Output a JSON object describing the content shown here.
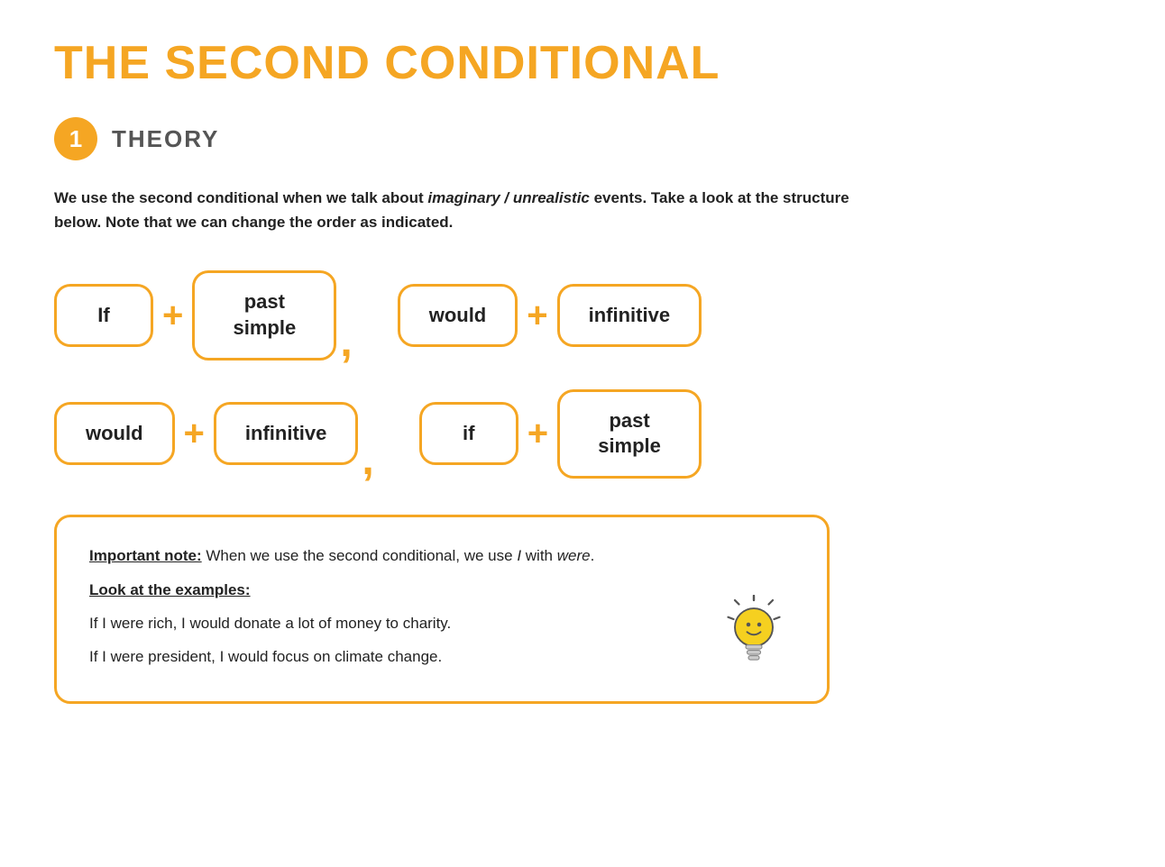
{
  "page": {
    "title": "THE SECOND CONDITIONAL",
    "section_number": "1",
    "section_label": "THEORY",
    "intro_text_before_italic": "We use the second conditional when we talk about ",
    "intro_italic": "imaginary / unrealistic",
    "intro_text_after_italic": " events. Take a look at the structure below. Note that we can change the order as indicated.",
    "row1": {
      "box1": "If",
      "box2_line1": "past",
      "box2_line2": "simple",
      "box3": "would",
      "box4": "infinitive"
    },
    "row2": {
      "box1": "would",
      "box2": "infinitive",
      "box3": "if",
      "box4_line1": "past",
      "box4_line2": "simple"
    },
    "note": {
      "important_label": "Important note:",
      "important_text": " When we use the second conditional, we use ",
      "important_italic": "I",
      "important_text2": " with ",
      "important_italic2": "were",
      "important_end": ".",
      "examples_label": "Look at the examples:",
      "example1": "If I were rich, I would donate a lot of money to charity.",
      "example2": "If I were president, I would focus on climate change."
    }
  }
}
